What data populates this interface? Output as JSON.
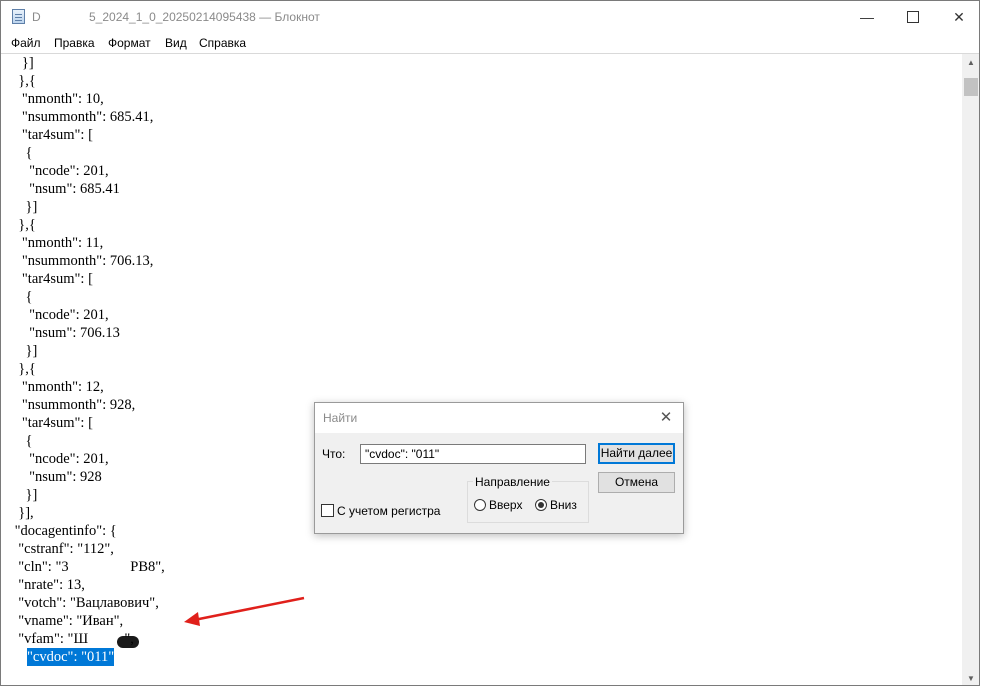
{
  "window": {
    "title_prefix": "D",
    "title": "5_2024_1_0_20250214095438 — Блокнот",
    "minimize": "—",
    "close": "✕"
  },
  "menu": [
    "Файл",
    "Правка",
    "Формат",
    "Вид",
    "Справка"
  ],
  "editor": {
    "lines": [
      "   }]",
      "  },{",
      "   \"nmonth\": 10,",
      "   \"nsummonth\": 685.41,",
      "   \"tar4sum\": [",
      "    {",
      "     \"ncode\": 201,",
      "     \"nsum\": 685.41",
      "    }]",
      "  },{",
      "   \"nmonth\": 11,",
      "   \"nsummonth\": 706.13,",
      "   \"tar4sum\": [",
      "    {",
      "     \"ncode\": 201,",
      "     \"nsum\": 706.13",
      "    }]",
      "  },{",
      "   \"nmonth\": 12,",
      "   \"nsummonth\": 928,",
      "   \"tar4sum\": [",
      "    {",
      "     \"ncode\": 201,",
      "     \"nsum\": 928",
      "    }]",
      "  }],",
      " \"docagentinfo\": {",
      "  \"cstranf\": \"112\",",
      "  \"cln\": \"3                 PB8\",",
      "  \"nrate\": 13,",
      "  \"votch\": \"Вацлавович\",",
      "  \"vname\": \"Иван\",",
      "  \"vfam\": \"Ш          \","
    ],
    "selected_line": "  \"cvdoc\": \"011\""
  },
  "find_dialog": {
    "title": "Найти",
    "close": "✕",
    "what_label": "Что:",
    "search_value": "\"cvdoc\": \"011\"",
    "find_next": "Найти далее",
    "cancel": "Отмена",
    "direction_label": "Направление",
    "up_label": "Вверх",
    "down_label": "Вниз",
    "direction_selected": "down",
    "match_case_label": "С учетом регистра",
    "match_case_checked": false
  },
  "colors": {
    "selection": "#0078d7",
    "arrow": "#e0201b"
  }
}
